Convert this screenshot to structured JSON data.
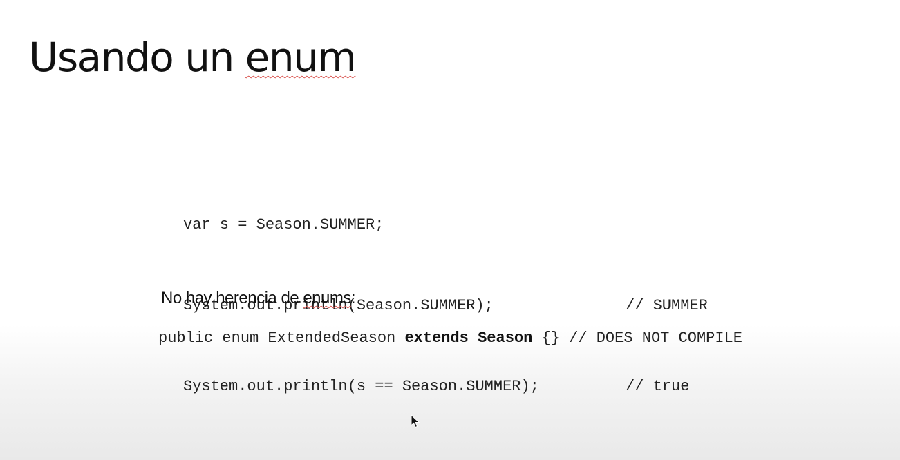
{
  "slide": {
    "title_plain": "Usando un ",
    "title_marked": "enum",
    "code_lines": [
      {
        "code": "var s = Season.SUMMER;",
        "comment": ""
      },
      {
        "code": "System.out.println(Season.SUMMER);",
        "comment": "// SUMMER"
      },
      {
        "code": "System.out.println(s == Season.SUMMER);",
        "comment": "// true"
      }
    ],
    "subheading_plain": "No hay herencia de ",
    "subheading_marked": "enums",
    "subheading_colon": ":",
    "compile_example": {
      "prefix": "public enum ExtendedSeason ",
      "bold": "extends Season",
      "suffix": " {} // DOES NOT COMPILE"
    }
  },
  "colors": {
    "spellcheck_underline": "#d9534f",
    "text": "#111111"
  },
  "icons": {
    "cursor": "mouse-pointer-icon"
  }
}
